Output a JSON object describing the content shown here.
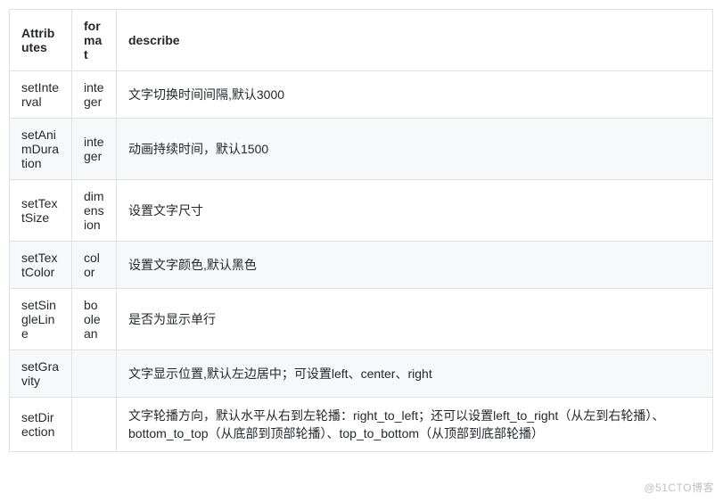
{
  "headers": {
    "attr": "Attributes",
    "fmt": "format",
    "desc": "describe"
  },
  "rows": [
    {
      "attr": "setInterval",
      "fmt": "integer",
      "desc": "文字切换时间间隔,默认3000"
    },
    {
      "attr": "setAnimDuration",
      "fmt": "integer",
      "desc": "动画持续时间，默认1500"
    },
    {
      "attr": "setTextSize",
      "fmt": "dimension",
      "desc": "设置文字尺寸"
    },
    {
      "attr": "setTextColor",
      "fmt": "color",
      "desc": "设置文字颜色,默认黑色"
    },
    {
      "attr": "setSingleLine",
      "fmt": "boolean",
      "desc": "是否为显示单行"
    },
    {
      "attr": "setGravity",
      "fmt": "",
      "desc": "文字显示位置,默认左边居中；可设置left、center、right"
    },
    {
      "attr": "setDirection",
      "fmt": "",
      "desc": "文字轮播方向，默认水平从右到左轮播：right_to_left；还可以设置left_to_right（从左到右轮播）、bottom_to_top（从底部到顶部轮播）、top_to_bottom（从顶部到底部轮播）"
    }
  ],
  "watermark": "@51CTO博客"
}
